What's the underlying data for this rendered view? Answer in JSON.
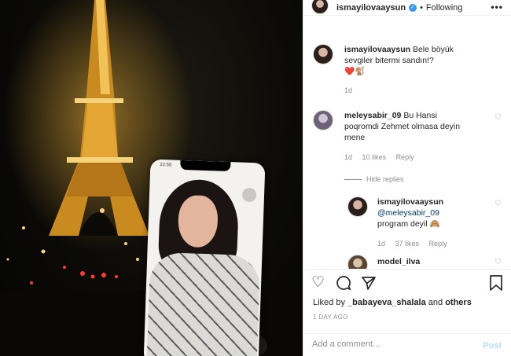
{
  "header": {
    "username": "ismayilovaaysun",
    "separator": "•",
    "follow_status": "Following",
    "more_glyph": "•••"
  },
  "comments": [
    {
      "username": "ismayilovaaysun",
      "text_line1": "Bele böyük",
      "text_line2": "sevgiler bitermi sandın!?",
      "emoji": "❤️🐒",
      "time": "1d"
    },
    {
      "username": "meleysabir_09",
      "text_line1": "Bu Hansi",
      "text_line2": "poqromdi Zehmet olmasa deyin",
      "text_line3": "mene",
      "time": "1d",
      "likes": "10 likes",
      "reply": "Reply",
      "hide_replies": "Hide replies"
    },
    {
      "username": "ismayilovaaysun",
      "mention": "@meleysabir_09",
      "text": "program deyil 🙈",
      "time": "1d",
      "likes": "37 likes",
      "reply": "Reply"
    },
    {
      "username": "model_ilva"
    }
  ],
  "footer": {
    "liked_by_prefix": "Liked by ",
    "liked_by_user": "_babayeva_shalala",
    "liked_by_suffix": " and ",
    "liked_by_others": "others",
    "time_ago": "1 DAY AGO",
    "comment_placeholder": "Add a comment...",
    "post_label": "Post"
  },
  "icons": {
    "heart": "heart-icon",
    "comment": "comment-icon",
    "share": "share-icon",
    "bookmark": "bookmark-icon"
  },
  "colors": {
    "verified_blue": "#3897f0",
    "post_disabled": "#b2dffc",
    "secondary_text": "#8e8e8e"
  },
  "photo": {
    "phone_time": "22:55"
  }
}
